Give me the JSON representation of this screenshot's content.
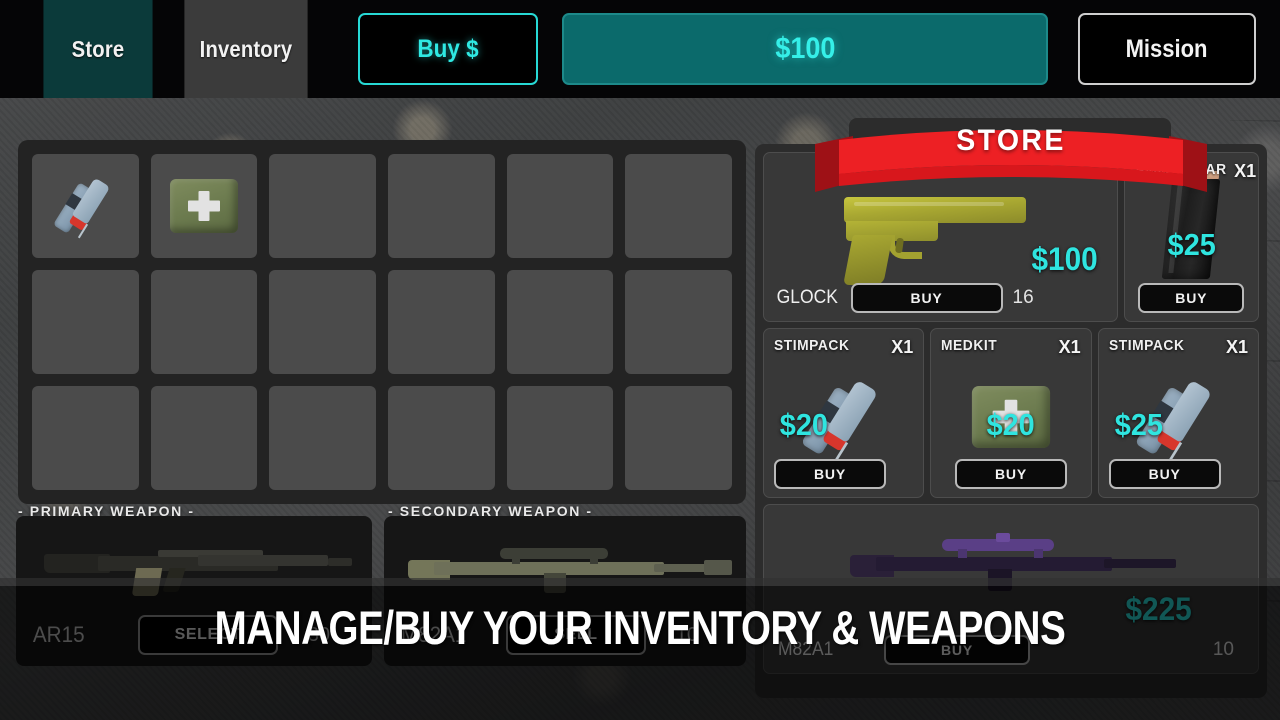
{
  "topbar": {
    "tabs": [
      {
        "label": "Store",
        "active": true
      },
      {
        "label": "Inventory",
        "active": false
      }
    ],
    "buy_button": "Buy $",
    "money": "$100",
    "mission_button": "Mission"
  },
  "inventory": {
    "slots": [
      {
        "item": "stimpack",
        "icon": "syringe-icon"
      },
      {
        "item": "medkit",
        "icon": "medkit-icon"
      },
      {
        "item": null,
        "icon": null
      },
      {
        "item": null,
        "icon": null
      },
      {
        "item": null,
        "icon": null
      },
      {
        "item": null,
        "icon": null
      },
      {
        "item": null,
        "icon": null
      },
      {
        "item": null,
        "icon": null
      },
      {
        "item": null,
        "icon": null
      },
      {
        "item": null,
        "icon": null
      },
      {
        "item": null,
        "icon": null
      },
      {
        "item": null,
        "icon": null
      },
      {
        "item": null,
        "icon": null
      },
      {
        "item": null,
        "icon": null
      },
      {
        "item": null,
        "icon": null
      },
      {
        "item": null,
        "icon": null
      },
      {
        "item": null,
        "icon": null
      },
      {
        "item": null,
        "icon": null
      }
    ]
  },
  "loadout": {
    "primary": {
      "title": "- PRIMARY WEAPON -",
      "name": "AR15",
      "button": "SELECT",
      "ammo": "30"
    },
    "secondary": {
      "title": "- SECONDARY WEAPON -",
      "name": "M82A1",
      "button": "SELL",
      "ammo": "10"
    }
  },
  "store": {
    "banner": "STORE",
    "items": [
      {
        "name": "GLOCK",
        "qty": null,
        "price": "$100",
        "ammo": "16",
        "buy_label": "BUY",
        "art": "glock-icon",
        "layout": "hero"
      },
      {
        "name": "AMMO SCAR",
        "qty": "X1",
        "price": "$25",
        "ammo": null,
        "buy_label": "BUY",
        "art": "magazine-icon",
        "layout": "small"
      },
      {
        "name": "STIMPACK",
        "qty": "X1",
        "price": "$20",
        "ammo": null,
        "buy_label": "BUY",
        "art": "syringe-icon",
        "layout": "third"
      },
      {
        "name": "MEDKIT",
        "qty": "X1",
        "price": "$20",
        "ammo": null,
        "buy_label": "BUY",
        "art": "medkit-icon",
        "layout": "third"
      },
      {
        "name": "STIMPACK",
        "qty": "X1",
        "price": "$25",
        "ammo": null,
        "buy_label": "BUY",
        "art": "syringe-icon",
        "layout": "third"
      },
      {
        "name": "M82A1",
        "qty": null,
        "price": "$225",
        "ammo": "10",
        "buy_label": "BUY",
        "art": "sniper-icon",
        "layout": "wide"
      }
    ]
  },
  "caption": "MANAGE/BUY YOUR INVENTORY & WEAPONS",
  "colors": {
    "accent_cyan": "#2fe5e0",
    "tab_active": "#0b3a3a",
    "tab_inactive": "#3b3b3b",
    "banner_red": "#ed2024",
    "money_bar": "#0b6a6b"
  }
}
